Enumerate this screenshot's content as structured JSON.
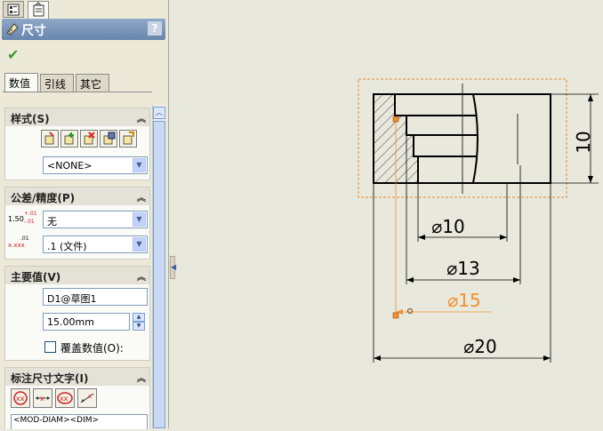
{
  "panel": {
    "title": "尺寸",
    "help_label": "?",
    "subtabs": [
      "数值",
      "引线",
      "其它"
    ],
    "style": {
      "header": "样式(S)",
      "buttons": [
        "add-style-icon",
        "add-style-icon",
        "delete-style-icon",
        "save-style-icon",
        "load-style-icon"
      ],
      "selected": "<NONE>"
    },
    "tolerance": {
      "header": "公差/精度(P)",
      "tolerance_value": "无",
      "precision_value": ".1 (文件)",
      "tolerance_icon_text": "1.50",
      "tolerance_icon_sup": "+.01",
      "tolerance_icon_sub": "-.01",
      "precision_icon_text": "x.xxx",
      "precision_icon_sup": ".01"
    },
    "primary_value": {
      "header": "主要值(V)",
      "name": "D1@草图1",
      "value": "15.00mm",
      "override_label": "覆盖数值(O):"
    },
    "dim_text": {
      "header": "标注尺寸文字(I)",
      "buttons": [
        "diameter-symbol-icon",
        "diameter-linear-icon",
        "diameter-xx-icon",
        "leader-icon"
      ],
      "text": "<MOD-DIAM><DIM>"
    }
  },
  "drawing": {
    "dims": [
      {
        "label": "⌀10",
        "state": "normal"
      },
      {
        "label": "⌀13",
        "state": "normal"
      },
      {
        "label": "⌀15",
        "state": "selected"
      },
      {
        "label": "⌀20",
        "state": "normal"
      },
      {
        "label": "10",
        "state": "normal"
      }
    ],
    "colors": {
      "background": "#e9e8dc",
      "geometry": "#000000",
      "selected": "#f29030"
    }
  }
}
